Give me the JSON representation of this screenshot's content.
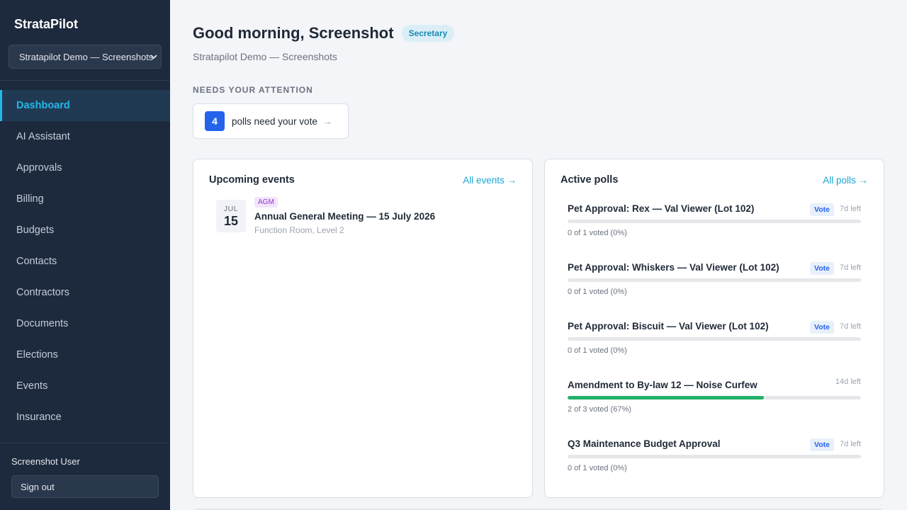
{
  "app": {
    "brand": "StrataPilot"
  },
  "org_select": {
    "value": "Stratapilot Demo — Screenshots"
  },
  "nav": [
    {
      "label": "Dashboard",
      "active": true
    },
    {
      "label": "AI Assistant"
    },
    {
      "label": "Approvals"
    },
    {
      "label": "Billing"
    },
    {
      "label": "Budgets"
    },
    {
      "label": "Contacts"
    },
    {
      "label": "Contractors"
    },
    {
      "label": "Documents"
    },
    {
      "label": "Elections"
    },
    {
      "label": "Events"
    },
    {
      "label": "Insurance"
    }
  ],
  "user": {
    "name": "Screenshot User",
    "signout_label": "Sign out"
  },
  "header": {
    "greeting": "Good morning, Screenshot",
    "role": "Secretary",
    "org_name": "Stratapilot Demo — Screenshots"
  },
  "attention": {
    "label": "NEEDS YOUR ATTENTION",
    "count": "4",
    "text": "polls need your vote",
    "arrow": "→"
  },
  "events": {
    "title": "Upcoming events",
    "link": "All events →",
    "items": [
      {
        "month": "JUL",
        "day": "15",
        "tag": "AGM",
        "title": "Annual General Meeting — 15 July 2026",
        "location": "Function Room, Level 2"
      }
    ]
  },
  "polls": {
    "title": "Active polls",
    "link": "All polls →",
    "items": [
      {
        "title": "Pet Approval: Rex — Val Viewer (Lot 102)",
        "vote_label": "Vote",
        "days_left": "7d left",
        "meta": "0 of 1 voted (0%)",
        "progress": 0
      },
      {
        "title": "Pet Approval: Whiskers — Val Viewer (Lot 102)",
        "vote_label": "Vote",
        "days_left": "7d left",
        "meta": "0 of 1 voted (0%)",
        "progress": 0
      },
      {
        "title": "Pet Approval: Biscuit — Val Viewer (Lot 102)",
        "vote_label": "Vote",
        "days_left": "7d left",
        "meta": "0 of 1 voted (0%)",
        "progress": 0
      },
      {
        "title": "Amendment to By-law 12 — Noise Curfew",
        "vote_label": "",
        "days_left": "14d left",
        "meta": "2 of 3 voted (67%)",
        "progress": 0.67
      },
      {
        "title": "Q3 Maintenance Budget Approval",
        "vote_label": "Vote",
        "days_left": "7d left",
        "meta": "0 of 1 voted (0%)",
        "progress": 0
      }
    ]
  },
  "colors": {
    "accent": "#22b8e6",
    "sidebar_bg": "#1d2a3e",
    "progress_fill": "#22b16a",
    "vote_blue": "#2563eb"
  }
}
